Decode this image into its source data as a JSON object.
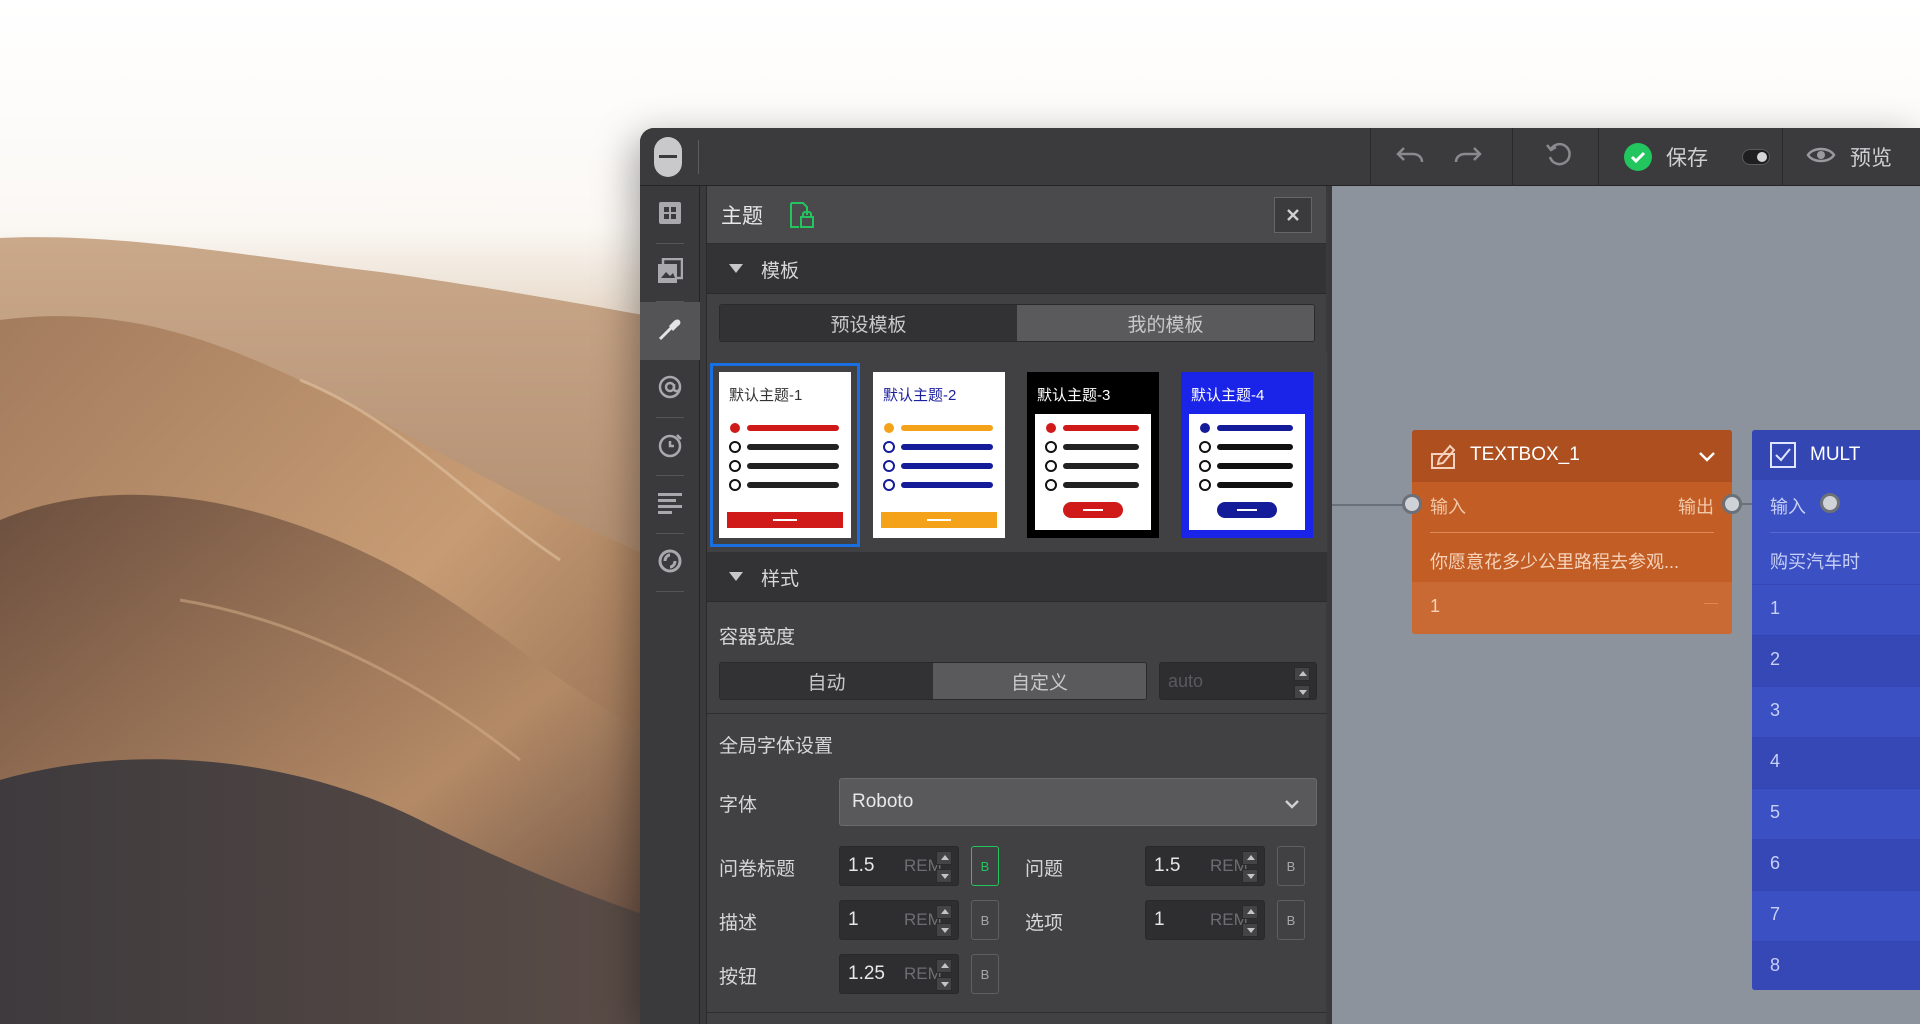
{
  "toolbar": {
    "save_label": "保存",
    "preview_label": "预览"
  },
  "rail": {
    "items": [
      "grid-icon",
      "pages-icon",
      "eyedropper-icon",
      "at-icon",
      "timer-icon",
      "align-left-icon",
      "target-icon"
    ],
    "active_index": 2
  },
  "panel": {
    "title": "主题",
    "templates_section": "模板",
    "template_tabs": [
      "预设模板",
      "我的模板"
    ],
    "themes": [
      {
        "name": "默认主题-1",
        "bg": "#ffffff",
        "accent": "#d01919"
      },
      {
        "name": "默认主题-2",
        "bg": "#ffffff",
        "accent": "#f5a21b"
      },
      {
        "name": "默认主题-3",
        "bg": "#000000",
        "accent": "#d01919"
      },
      {
        "name": "默认主题-4",
        "bg": "#1a24e8",
        "accent": "#141c9a"
      }
    ],
    "style_section": "样式",
    "container_width_label": "容器宽度",
    "width_options": [
      "自动",
      "自定义"
    ],
    "width_placeholder": "auto",
    "global_font_label": "全局字体设置",
    "font_label": "字体",
    "font_value": "Roboto",
    "sizes": [
      {
        "label": "问卷标题",
        "value": "1.5",
        "unit": "REM",
        "bold_active": true
      },
      {
        "label": "问题",
        "value": "1.5",
        "unit": "REM",
        "bold_active": false
      },
      {
        "label": "描述",
        "value": "1",
        "unit": "REM",
        "bold_active": false
      },
      {
        "label": "选项",
        "value": "1",
        "unit": "REM",
        "bold_active": false
      },
      {
        "label": "按钮",
        "value": "1.25",
        "unit": "REM",
        "bold_active": false
      }
    ],
    "bold_label": "B"
  },
  "canvas": {
    "textbox_node": {
      "title": "TEXTBOX_1",
      "input_label": "输入",
      "output_label": "输出",
      "question": "你愿意花多少公里路程去参观...",
      "value": "1",
      "dash": "—"
    },
    "mult_node": {
      "title": "MULT",
      "input_label": "输入",
      "question": "购买汽车时",
      "rows": [
        "1",
        "2",
        "3",
        "4",
        "5",
        "6",
        "7",
        "8"
      ]
    }
  },
  "colors": {
    "accent_green": "#22c55e",
    "selection_blue": "#1a6fe0",
    "textbox_orange": "#c25d25",
    "mult_blue": "#3b50c2"
  }
}
